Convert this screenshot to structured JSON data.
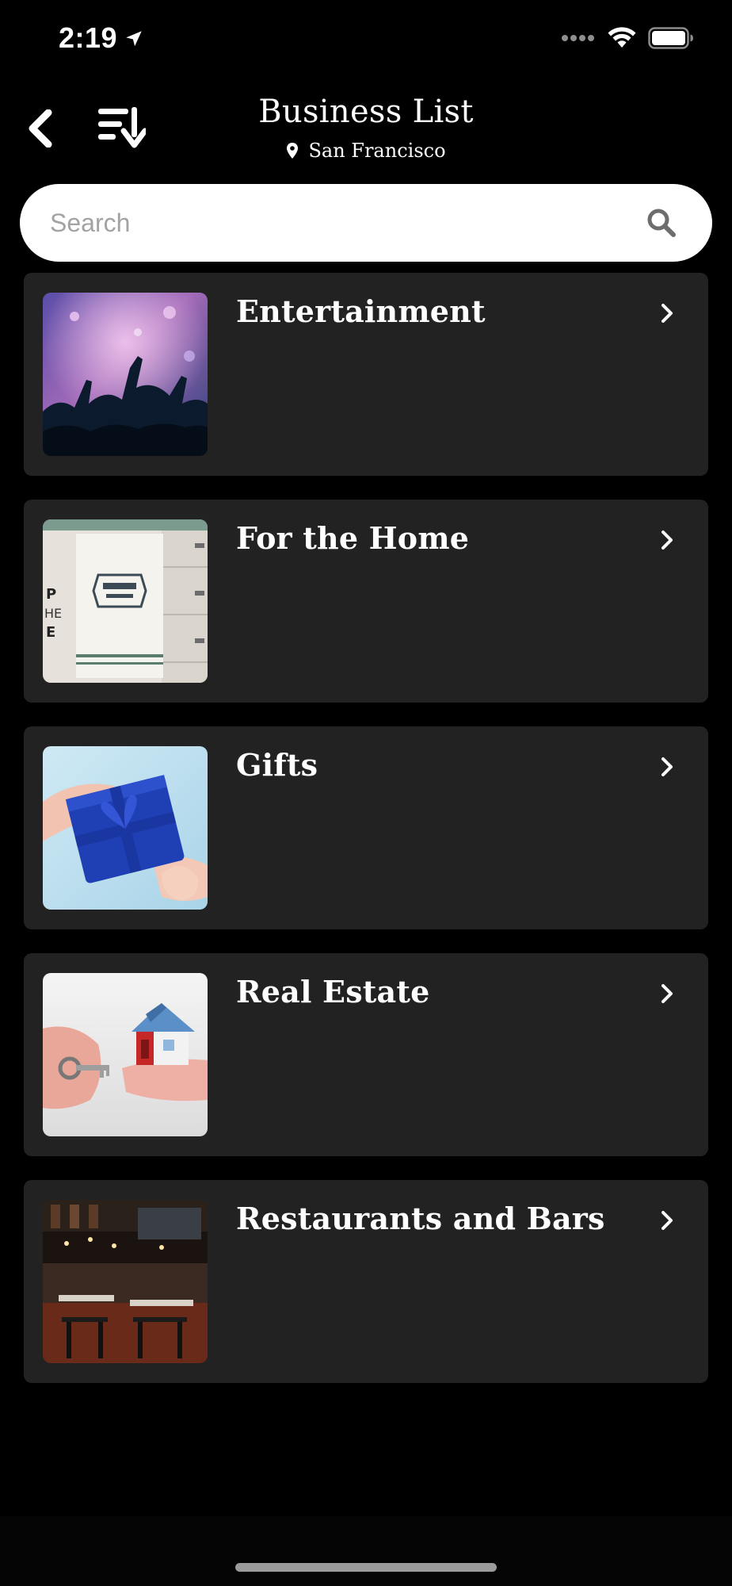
{
  "status_bar": {
    "time": "2:19",
    "icons": [
      "location-arrow-icon",
      "signal-dots-icon",
      "wifi-icon",
      "battery-icon"
    ]
  },
  "nav": {
    "title": "Business List",
    "location": "San Francisco",
    "icons": [
      "back-chevron-icon",
      "sort-descending-icon",
      "map-pin-icon"
    ]
  },
  "search": {
    "placeholder": "Search",
    "value": "",
    "icon": "magnifier-icon"
  },
  "categories": [
    {
      "label": "Entertainment",
      "image": "concert crowd with raised hands"
    },
    {
      "label": "For the Home",
      "image": "kitchen towel hanging on drawers"
    },
    {
      "label": "Gifts",
      "image": "hands giving a blue gift box"
    },
    {
      "label": "Real Estate",
      "image": "hands holding keys and a small house"
    },
    {
      "label": "Restaurants and Bars",
      "image": "restaurant dining room interior"
    }
  ],
  "colors": {
    "background": "#000000",
    "card": "#222222",
    "text": "#ffffff",
    "search_background": "#ffffff",
    "placeholder": "#a3a3a3",
    "home_indicator": "#9b9b9b"
  }
}
